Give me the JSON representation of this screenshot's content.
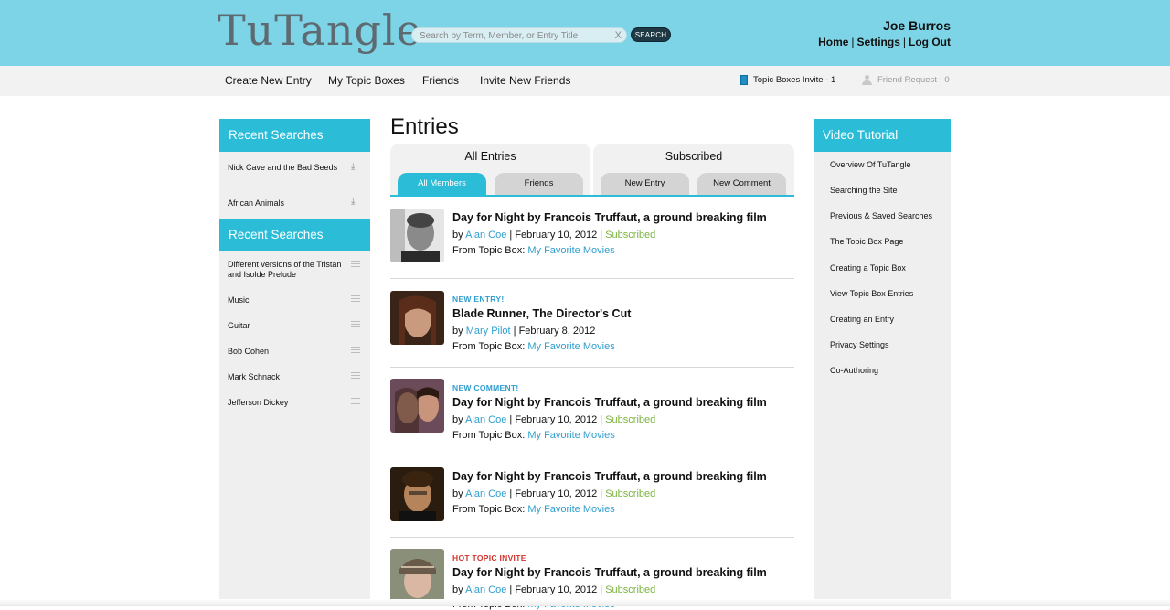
{
  "header": {
    "logo": "TuTangle",
    "search_placeholder": "Search by Term, Member, or Entry Title",
    "clear_label": "X",
    "search_button": "SEARCH",
    "user_name": "Joe Burros",
    "links": [
      "Home",
      "Settings",
      "Log Out"
    ]
  },
  "nav": {
    "items": [
      "Create New Entry",
      "My Topic Boxes",
      "Friends",
      "Invite New Friends"
    ],
    "topic_invite": "Topic Boxes Invite - 1",
    "friend_request": "Friend Request - 0"
  },
  "left_sidebar": {
    "recent_searches_1": {
      "title": "Recent Searches",
      "items": [
        "Nick Cave and the Bad Seeds",
        "African Animals"
      ]
    },
    "recent_searches_2": {
      "title": "Recent Searches",
      "items": [
        "Different versions of the Tristan and Isolde Prelude",
        "Music",
        "Guitar",
        "Bob Cohen",
        "Mark Schnack",
        "Jefferson Dickey"
      ]
    }
  },
  "main": {
    "title": "Entries",
    "tab_groups": [
      {
        "label": "All Entries",
        "pills": [
          "All Members",
          "Friends"
        ]
      },
      {
        "label": "Subscribed",
        "pills": [
          "New Entry",
          "New Comment"
        ]
      }
    ],
    "entries": [
      {
        "tag": "",
        "title": "Day for Night by Francois Truffaut, a ground breaking film",
        "by": "by",
        "author": "Alan Coe",
        "date": "February 10, 2012",
        "status": "Subscribed",
        "from_label": "From Topic Box:",
        "topic_box": "My Favorite Movies"
      },
      {
        "tag": "NEW ENTRY!",
        "title": "Blade Runner, The Director's Cut",
        "by": "by",
        "author": "Mary Pilot",
        "date": "February 8, 2012",
        "status": "",
        "from_label": "From Topic Box:",
        "topic_box": "My Favorite Movies"
      },
      {
        "tag": "NEW COMMENT!",
        "title": "Day for Night by Francois Truffaut, a ground breaking film",
        "by": "by",
        "author": "Alan Coe",
        "date": "February 10, 2012",
        "status": "Subscribed",
        "from_label": "From Topic Box:",
        "topic_box": "My Favorite Movies"
      },
      {
        "tag": "",
        "title": "Day for Night by Francois Truffaut, a ground breaking film",
        "by": "by",
        "author": "Alan Coe",
        "date": "February 10, 2012",
        "status": "Subscribed",
        "from_label": "From Topic Box:",
        "topic_box": "My Favorite Movies"
      },
      {
        "tag": "HOT TOPIC INVITE",
        "title": "Day for Night by Francois Truffaut, a ground breaking film",
        "by": "by",
        "author": "Alan Coe",
        "date": "February 10, 2012",
        "status": "Subscribed",
        "from_label": "From Topic Box:",
        "topic_box": "My Favorite Movies"
      }
    ]
  },
  "right_sidebar": {
    "title": "Video Tutorial",
    "items": [
      "Overview Of TuTangle",
      "Searching the Site",
      "Previous & Saved Searches",
      "The Topic Box Page",
      "Creating a Topic Box",
      "View Topic Box Entries",
      "Creating an Entry",
      "Privacy Settings",
      "Co-Authoring"
    ]
  },
  "colors": {
    "header_bg": "#7dd4e6",
    "accent": "#2bbdd8",
    "link": "#2f9fcf",
    "subscribed": "#7ab33f",
    "hot": "#d0342c"
  },
  "icons": [
    "download-icon",
    "list-icon",
    "topic-box-icon",
    "friend-icon"
  ]
}
